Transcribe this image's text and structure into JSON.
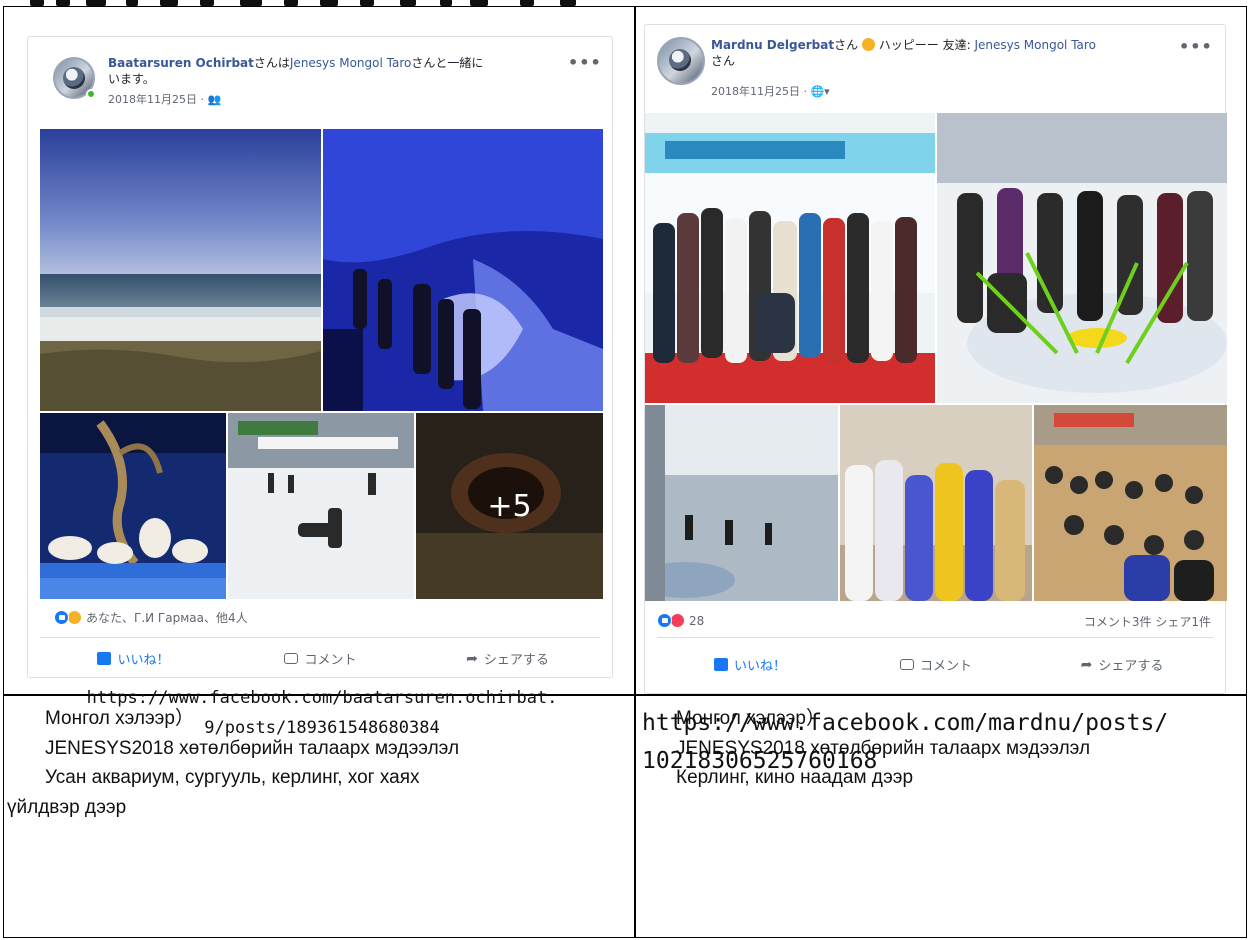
{
  "left_post": {
    "author": "Baatarsuren Ochirbat",
    "with_text_1": "さんは",
    "tagged": "Jenesys Mongol Taro",
    "with_text_2": "さんと一緒に",
    "with_text_3": "います。",
    "date": "2018年11月25日 · ",
    "more_label": "•••",
    "photo_more_count": "+5",
    "reactions_text": "あなた、Г.И Гармаа、他4人",
    "like_label": "いいね！",
    "comment_label": "コメント",
    "share_label": "シェアする"
  },
  "left_url": {
    "line1": "https://www.facebook.com/baatarsuren.ochirbat.",
    "line2": "9/posts/189361548680384"
  },
  "right_post": {
    "author": "Mardnu Delgerbat",
    "feeling_text": "さん",
    "feeling": "ハッピー",
    "feeling_tail": "ー 友達: ",
    "tagged": "Jenesys Mongol Taro",
    "tagged_tail": "さん",
    "date": "2018年11月25日 · ",
    "more_label": "•••",
    "reaction_count": "28",
    "comments_shares": "コメント3件 シェア1件",
    "like_label": "いいね！",
    "comment_label": "コメント",
    "share_label": "シェアする"
  },
  "right_url": {
    "line1": "https://www.facebook.com/mardnu/posts/",
    "line2": "10218306525760168"
  },
  "left_caption": {
    "line1": "Монгол хэлээр）",
    "line2": "JENESYS2018 хөтөлбөрийн талаарх мэдээлэл",
    "line3": "Усан аквариум, сургууль, керлинг, хог хаях",
    "line4": "үйлдвэр дээр"
  },
  "right_caption": {
    "line1": "Монгол хэлээр）",
    "line2": "JENESYS2018 хөтөлбөрийн талаарх мэдээлэл",
    "line3": "Керлинг, кино наадам дээр"
  },
  "colors": {
    "facebook_blue": "#1877f2",
    "name_blue": "#385898",
    "online_green": "#42b72a"
  },
  "icons": [
    "globe-icon",
    "friends-icon",
    "like-icon",
    "comment-icon",
    "share-icon",
    "more-icon",
    "happy-emoji-icon"
  ]
}
